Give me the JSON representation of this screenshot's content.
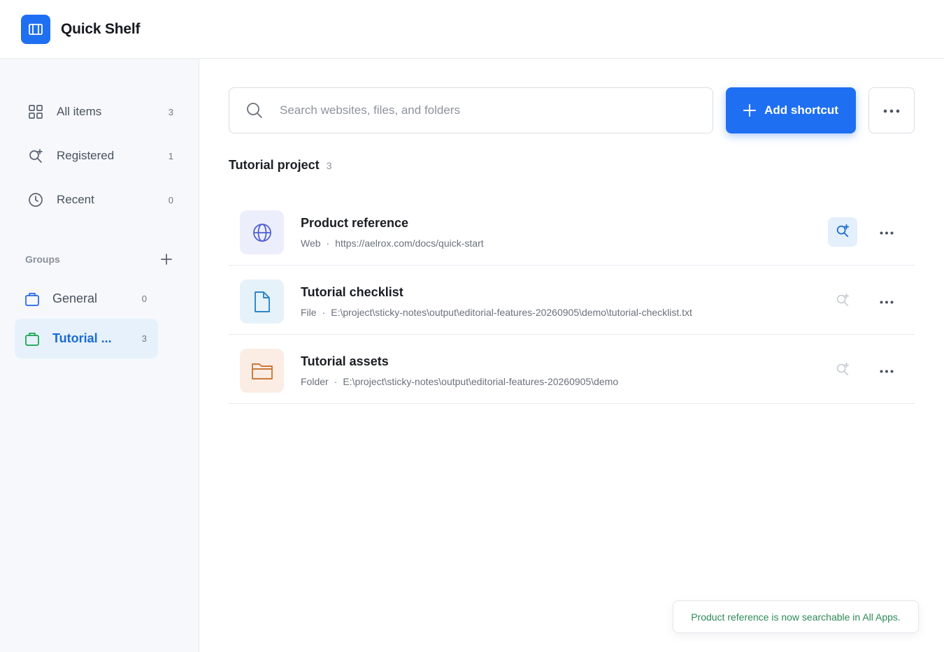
{
  "app": {
    "title": "Quick Shelf"
  },
  "sidebar": {
    "nav": [
      {
        "label": "All items",
        "count": "3",
        "icon": "grid-icon"
      },
      {
        "label": "Registered",
        "count": "1",
        "icon": "search-plus-icon"
      },
      {
        "label": "Recent",
        "count": "0",
        "icon": "clock-icon"
      }
    ],
    "groups_title": "Groups",
    "groups": [
      {
        "label": "General",
        "count": "0",
        "icon": "bag-icon",
        "color": "#2563eb"
      },
      {
        "label": "Tutorial ...",
        "count": "3",
        "icon": "bag-icon",
        "color": "#16a34a",
        "active": true
      }
    ]
  },
  "search": {
    "placeholder": "Search websites, files, and folders",
    "value": ""
  },
  "toolbar": {
    "add_label": "Add shortcut"
  },
  "section": {
    "title": "Tutorial project",
    "count": "3"
  },
  "items": [
    {
      "name": "Product reference",
      "type": "Web",
      "path": "https://aelrox.com/docs/quick-start",
      "icon": "globe-icon",
      "registered": true,
      "accent": "#4f5fd0",
      "tile_bg": "#eceefb"
    },
    {
      "name": "Tutorial checklist",
      "type": "File",
      "path": "E:\\project\\sticky-notes\\output\\editorial-features-20260905\\demo\\tutorial-checklist.txt",
      "icon": "file-icon",
      "registered": false,
      "accent": "#2b86c5",
      "tile_bg": "#e6f2f9"
    },
    {
      "name": "Tutorial assets",
      "type": "Folder",
      "path": "E:\\project\\sticky-notes\\output\\editorial-features-20260905\\demo",
      "icon": "folder-icon",
      "registered": false,
      "accent": "#c97a3a",
      "tile_bg": "#fbede4"
    }
  ],
  "toast": {
    "message": "Product reference is now searchable in All Apps."
  },
  "colors": {
    "brand": "#1f6ff2",
    "success": "#2e8a58"
  }
}
